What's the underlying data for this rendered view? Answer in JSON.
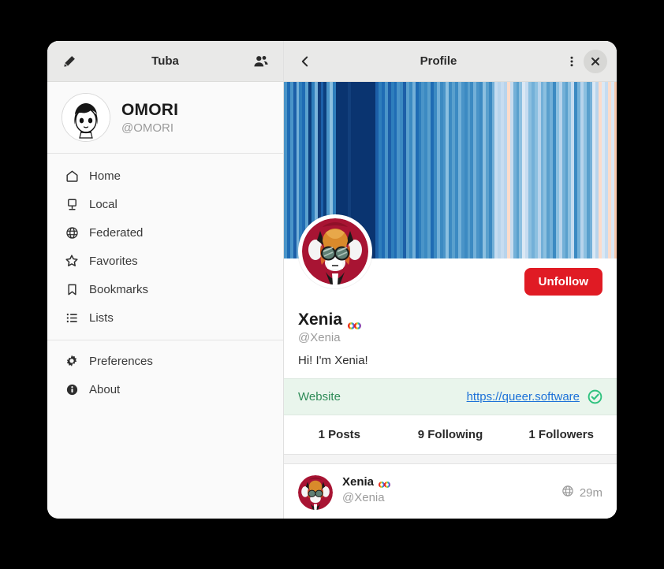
{
  "sidebar": {
    "title": "Tuba",
    "compose_icon": "pencil-icon",
    "accounts_icon": "people-icon",
    "account": {
      "display_name": "OMORI",
      "handle": "@OMORI",
      "avatar_alt": "omori-avatar"
    },
    "items": [
      {
        "label": "Home",
        "icon": "home-icon"
      },
      {
        "label": "Local",
        "icon": "monitor-icon"
      },
      {
        "label": "Federated",
        "icon": "globe-icon"
      },
      {
        "label": "Favorites",
        "icon": "star-icon"
      },
      {
        "label": "Bookmarks",
        "icon": "bookmark-icon"
      },
      {
        "label": "Lists",
        "icon": "list-icon"
      }
    ],
    "footer_items": [
      {
        "label": "Preferences",
        "icon": "gear-icon"
      },
      {
        "label": "About",
        "icon": "info-icon"
      }
    ]
  },
  "main": {
    "header": {
      "title": "Profile",
      "back_icon": "chevron-left-icon",
      "menu_icon": "three-dots-icon",
      "close_icon": "close-icon"
    },
    "profile": {
      "display_name": "Xenia",
      "name_emoji": "rainbow-infinity-emoji",
      "handle": "@Xenia",
      "bio": "Hi! I'm Xenia!",
      "follow_button": "Unfollow",
      "avatar_alt": "xenia-fox-avatar",
      "field": {
        "label": "Website",
        "value": "https://queer.software",
        "verified_icon": "verified-check-icon"
      },
      "stats": [
        {
          "label": "1 Posts"
        },
        {
          "label": "9 Following"
        },
        {
          "label": "1 Followers"
        }
      ]
    },
    "posts": [
      {
        "display_name": "Xenia",
        "name_emoji": "rainbow-infinity-emoji",
        "handle": "@Xenia",
        "visibility_icon": "globe-icon",
        "time": "29m"
      }
    ]
  },
  "colors": {
    "accent_danger": "#e01b24",
    "link": "#1c71d8",
    "verified_green": "#2ec27e",
    "field_bg": "#e9f5ec",
    "header_bg": "#e9e9e8",
    "sidebar_bg": "#fafafa"
  },
  "banner_stripes": [
    "#4a94c8",
    "#1f6cb4",
    "#4a94c8",
    "#1c5fa8",
    "#73b0d8",
    "#2e7ebc",
    "#1f6cb4",
    "#5aa0cd",
    "#0c3f7e",
    "#2e7ebc",
    "#78b3da",
    "#123f7c",
    "#1c5fa8",
    "#0c3f7e",
    "#4a94c8",
    "#8cc0e0",
    "#2e7ebc",
    "#0a3470",
    "#0a3470",
    "#0a3470",
    "#0a3470",
    "#123f7c",
    "#0a3470",
    "#0a3470",
    "#0a3470",
    "#0a3470",
    "#0a3470",
    "#0a3470",
    "#0a3470",
    "#0a3470",
    "#1c5fa8",
    "#2e7ebc",
    "#1f6cb4",
    "#4a94c8",
    "#1c5fa8",
    "#2e7ebc",
    "#1f6cb4",
    "#4a94c8",
    "#3c8ac2",
    "#1c5fa8",
    "#5aa0cd",
    "#3c8ac2",
    "#73b0d8",
    "#1f6cb4",
    "#2e7ebc",
    "#4a94c8",
    "#3c8ac2",
    "#5aa0cd",
    "#1f6cb4",
    "#3c8ac2",
    "#73b0d8",
    "#3c8ac2",
    "#4a94c8",
    "#8cc0e0",
    "#3c8ac2",
    "#5aa0cd",
    "#3c8ac2",
    "#73b0d8",
    "#4a94c8",
    "#3c8ac2",
    "#5aa0cd",
    "#3c8ac2",
    "#73b0d8",
    "#4a94c8",
    "#3c8ac2",
    "#8cc0e0",
    "#5aa0cd",
    "#3c8ac2",
    "#73b0d8",
    "#c6dcf0",
    "#b8d4ec",
    "#c6dcf0",
    "#b8d4ec",
    "#fbdccb",
    "#c6dcf0",
    "#73b0d8",
    "#5aa0cd",
    "#8cc0e0",
    "#dbe8f4",
    "#c6dcf0",
    "#8cc0e0",
    "#73b0d8",
    "#8cc0e0",
    "#b8d4ec",
    "#73b0d8",
    "#8cc0e0",
    "#5aa0cd",
    "#73b0d8",
    "#3c8ac2",
    "#8cc0e0",
    "#b8d4ec",
    "#73b0d8",
    "#5aa0cd",
    "#8cc0e0",
    "#c6dcf0",
    "#3c8ac2",
    "#73b0d8",
    "#b8d4ec",
    "#8cc0e0",
    "#5aa0cd",
    "#73b0d8",
    "#dbe8f4",
    "#b8d4ec",
    "#fbdccb",
    "#dbe8f4",
    "#c6dcf0",
    "#fbdccb",
    "#dbe8f4",
    "#f9c9ad"
  ]
}
